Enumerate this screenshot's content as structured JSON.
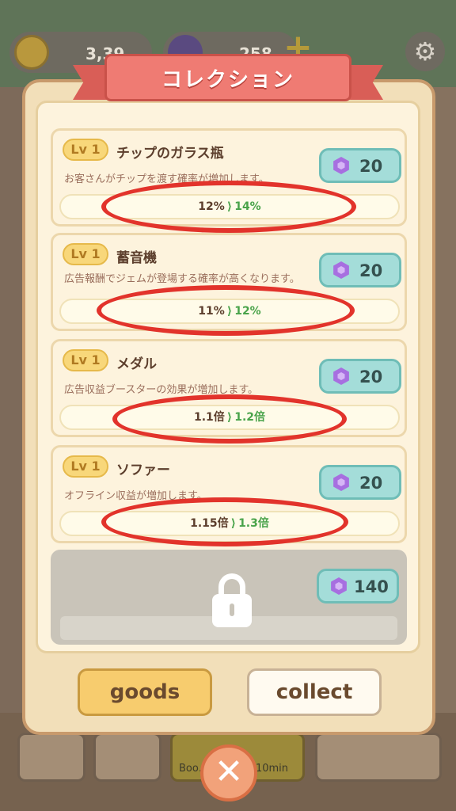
{
  "hud": {
    "coins": "3,39…",
    "gems": "258"
  },
  "background": {
    "boost_label": "Boo…",
    "timer_label": "10min"
  },
  "modal": {
    "title": "コレクション",
    "cards": [
      {
        "level": "Lv 1",
        "name": "チップのガラス瓶",
        "description": "お客さんがチップを渡す確率が増加します。",
        "price": "20",
        "current": "12%",
        "next": "14%"
      },
      {
        "level": "Lv 1",
        "name": "蓄音機",
        "description": "広告報酬でジェムが登場する確率が高くなります。",
        "price": "20",
        "current": "11%",
        "next": "12%"
      },
      {
        "level": "Lv 1",
        "name": "メダル",
        "description": "広告収益ブースターの効果が増加します。",
        "price": "20",
        "current": "1.1倍",
        "next": "1.2倍"
      },
      {
        "level": "Lv 1",
        "name": "ソファー",
        "description": "オフライン収益が増加します。",
        "price": "20",
        "current": "1.15倍",
        "next": "1.3倍"
      }
    ],
    "locked_card": {
      "price": "140"
    },
    "goods_label": "goods",
    "collect_label": "collect",
    "close_symbol": "✕"
  },
  "arrow_symbol": "⟩",
  "colors": {
    "ribbon": "#ef7b73",
    "highlight_oval": "#e2332b",
    "increase_text": "#49a34a",
    "price_badge": "#a4ddd9"
  }
}
